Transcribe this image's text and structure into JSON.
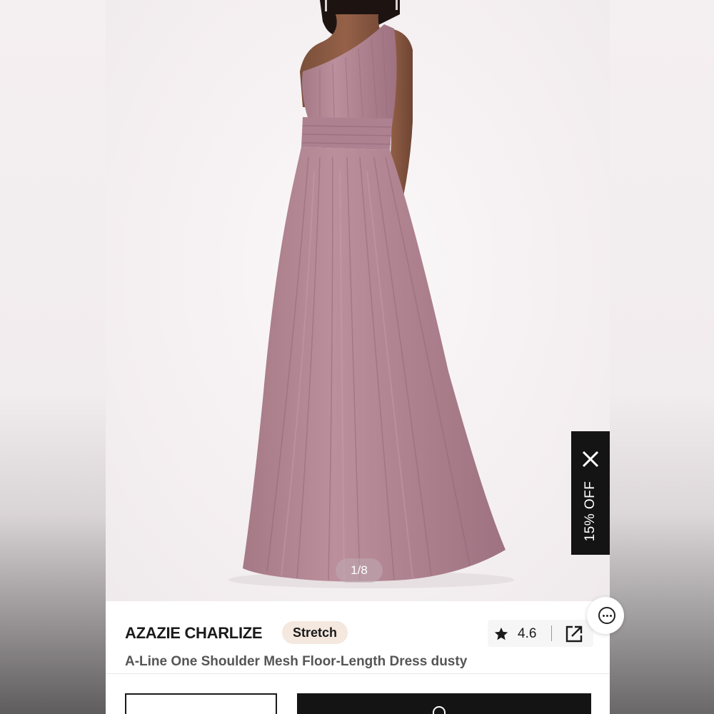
{
  "product": {
    "brand": "AZAZIE CHARLIZE",
    "badge": "Stretch",
    "rating": "4.6",
    "description": "A-Line One Shoulder Mesh Floor-Length Dress dusty"
  },
  "gallery": {
    "counter": "1/8",
    "image_subject": "model-in-dusty-rose-one-shoulder-gown"
  },
  "promo": {
    "label": "15% OFF"
  },
  "icons": {
    "close": "close-icon",
    "star": "star-icon",
    "share": "share-external-icon",
    "chat": "chat-icon",
    "bag": "bag-icon"
  },
  "colors": {
    "dress": "#b58896",
    "promo_bg": "#141414",
    "badge_bg": "#f4e8df",
    "text_primary": "#1a1a1a",
    "text_secondary": "#555555"
  }
}
